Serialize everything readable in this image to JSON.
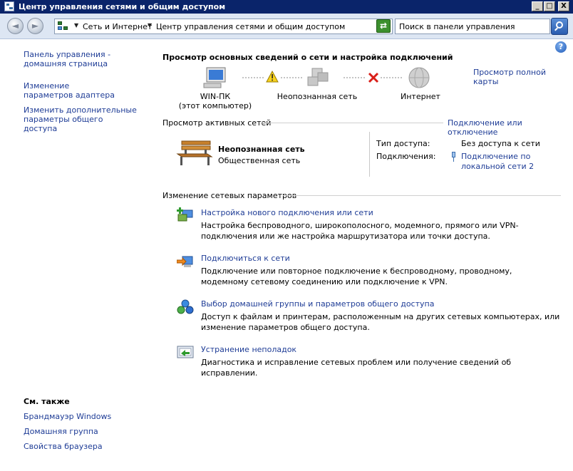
{
  "window": {
    "title": "Центр управления сетями и общим доступом",
    "minimize": "_",
    "maximize": "□",
    "close": "X"
  },
  "toolbar": {
    "back": "◄",
    "forward": "►",
    "breadcrumb_sep": "▼",
    "crumbs": [
      "Сеть и Интернет",
      "Центр управления сетями и общим доступом"
    ],
    "search_placeholder": "Поиск в панели управления"
  },
  "help": "?",
  "left_pane": {
    "links": [
      "Панель управления - домашняя страница",
      "Изменение параметров адаптера",
      "Изменить дополнительные параметры общего доступа"
    ],
    "see_also_title": "См. также",
    "see_also": [
      "Брандмауэр Windows",
      "Домашняя группа",
      "Свойства браузера"
    ]
  },
  "main": {
    "heading": "Просмотр основных сведений о сети и настройка подключений",
    "full_map_link": "Просмотр полной карты",
    "map_nodes": [
      {
        "label_line1": "WIN-ПК",
        "label_line2": "(этот компьютер)"
      },
      {
        "label_line1": "Неопознанная сеть",
        "label_line2": ""
      },
      {
        "label_line1": "Интернет",
        "label_line2": ""
      }
    ],
    "active_networks_title": "Просмотр активных сетей",
    "connect_disconnect_link": "Подключение или отключение",
    "network": {
      "name": "Неопознанная сеть",
      "category": "Общественная сеть",
      "access_type_label": "Тип доступа:",
      "access_type_value": "Без доступа к сети",
      "connections_label": "Подключения:",
      "connections_value_line1": "Подключение по",
      "connections_value_line2": "локальной сети 2"
    },
    "change_settings_title": "Изменение сетевых параметров",
    "tasks": [
      {
        "title": "Настройка нового подключения или сети",
        "desc": "Настройка беспроводного, широкополосного, модемного, прямого или VPN-подключения или же настройка маршрутизатора или точки доступа."
      },
      {
        "title": "Подключиться к сети",
        "desc": "Подключение или повторное подключение к беспроводному, проводному, модемному сетевому соединению или подключение к VPN."
      },
      {
        "title": "Выбор домашней группы и параметров общего доступа",
        "desc": "Доступ к файлам и принтерам, расположенным на других сетевых компьютерах, или изменение параметров общего доступа."
      },
      {
        "title": "Устранение неполадок",
        "desc": "Диагностика и исправление сетевых проблем или получение сведений об исправлении."
      }
    ]
  }
}
